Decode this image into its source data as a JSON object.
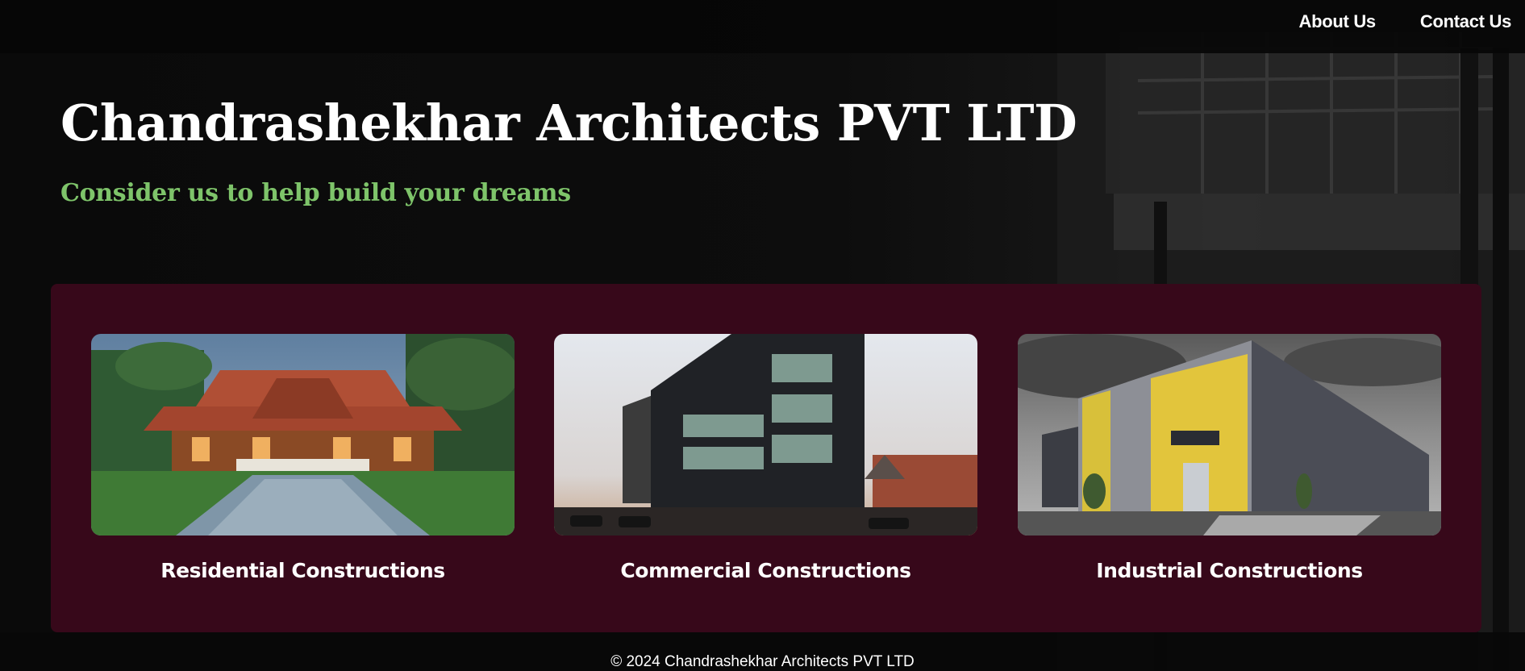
{
  "nav": {
    "items": [
      {
        "label": "About Us"
      },
      {
        "label": "Contact Us"
      }
    ]
  },
  "hero": {
    "title": "Chandrashekhar Architects PVT LTD",
    "subtitle": "Consider us to help build your dreams"
  },
  "services": [
    {
      "title": "Residential Constructions",
      "image": "house-photo"
    },
    {
      "title": "Commercial Constructions",
      "image": "office-building-photo"
    },
    {
      "title": "Industrial Constructions",
      "image": "warehouse-photo"
    }
  ],
  "footer": {
    "copyright": "© 2024 Chandrashekhar Architects PVT LTD"
  },
  "colors": {
    "page_bg": "#0c0c0c",
    "panel_bg": "#37081a",
    "subtitle": "#7ec46a",
    "text": "#ffffff"
  }
}
